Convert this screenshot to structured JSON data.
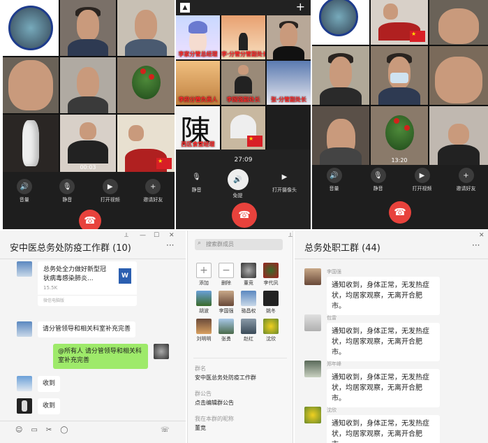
{
  "phone1": {
    "tile_time": "00:03",
    "controls": [
      {
        "icon": "speaker-icon",
        "label": "音量"
      },
      {
        "icon": "mic-off-icon",
        "label": "静音"
      },
      {
        "icon": "camera-icon",
        "label": "打开视频"
      },
      {
        "icon": "add-user-icon",
        "label": "邀请好友"
      }
    ],
    "seal_text": "1968~2018"
  },
  "phone2": {
    "labels": [
      "李家分管总经理",
      "李·分管分管副处长",
      "李府分管负责人",
      "李国强副处长",
      "张·分管副处长",
      "西区食堂经理"
    ],
    "calligraphy": "陳",
    "timer": "27:09",
    "controls": [
      {
        "icon": "mic-icon",
        "label": "静音"
      },
      {
        "icon": "speaker-icon",
        "label": "免提"
      },
      {
        "icon": "camera-icon",
        "label": "打开摄像头"
      }
    ]
  },
  "phone3": {
    "tile_time": "13:20",
    "controls": [
      {
        "icon": "speaker-icon",
        "label": "音量"
      },
      {
        "icon": "mic-off-icon",
        "label": "静音"
      },
      {
        "icon": "camera-icon",
        "label": "打开视频"
      },
      {
        "icon": "add-user-icon",
        "label": "邀请好友"
      }
    ]
  },
  "chat_left": {
    "title": "安中医总务处防疫工作群 (10)",
    "file": {
      "name": "总务处全力做好新型冠状病毒感染肺炎...",
      "size": "15.5K",
      "source": "微信电脑版",
      "type": "W"
    },
    "msgs": [
      "请分管领导和相关科室补充完善",
      "@所有人  请分管领导和相关科室补充完善",
      "收到",
      "收到"
    ]
  },
  "members_panel": {
    "search_placeholder": "搜索群成员",
    "members": [
      "添加",
      "删除",
      "董竞",
      "李代凤",
      "胡波",
      "李国强",
      "骆昌权",
      "姚冬",
      "刘明明",
      "张勇",
      "赵红",
      "沈欣"
    ],
    "group_name_label": "群名",
    "group_name": "安中医总务处防疫工作群",
    "notice_label": "群公告",
    "notice": "点击编辑群公告",
    "nick_label": "我在本群的昵称",
    "nick": "董竞"
  },
  "chat_right": {
    "title": "总务处职工群 (44)",
    "msgs": [
      {
        "name": "李国强",
        "text": "通知收到，身体正常，无发热症状，均居家观察，无离开合肥市。"
      },
      {
        "name": "包雷",
        "text": "通知收到，身体正常，无发热症状，均居家观察，无离开合肥市。"
      },
      {
        "name": "郑年峰",
        "text": "通知收到，身体正常，无发热症状，均居家观察，无离开合肥市。"
      },
      {
        "name": "沈欣",
        "text": "通知收到，身体正常，无发热症状，均居家观察，无离开合肥市。"
      }
    ]
  }
}
